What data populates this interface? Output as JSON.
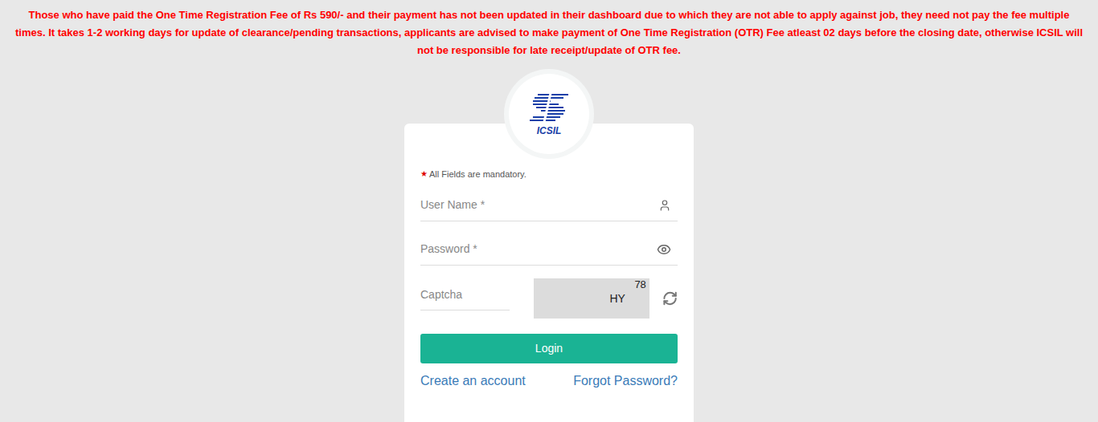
{
  "notice": "Those who have paid the One Time Registration Fee of Rs 590/- and their payment has not been updated in their dashboard due to which they are not able to apply against job, they need not pay the fee multiple times. It takes 1-2 working days for update of clearance/pending transactions, applicants are advised to make payment of One Time Registration (OTR) Fee atleast 02 days before the closing date, otherwise ICSIL will not be responsible for late receipt/update of OTR fee.",
  "logo": {
    "text": "ICSIL"
  },
  "form": {
    "required_note": {
      "marker": "★",
      "text": "All Fields are mandatory."
    },
    "fields": [
      {
        "label": "User Name *",
        "kind": "text"
      },
      {
        "label": "Password *",
        "kind": "password"
      }
    ],
    "captcha": {
      "placeholder": "Captcha",
      "code_top": "78",
      "code_bottom": "HY"
    },
    "login_button": "Login",
    "links": [
      "Create an account",
      "Forgot Password?"
    ]
  }
}
